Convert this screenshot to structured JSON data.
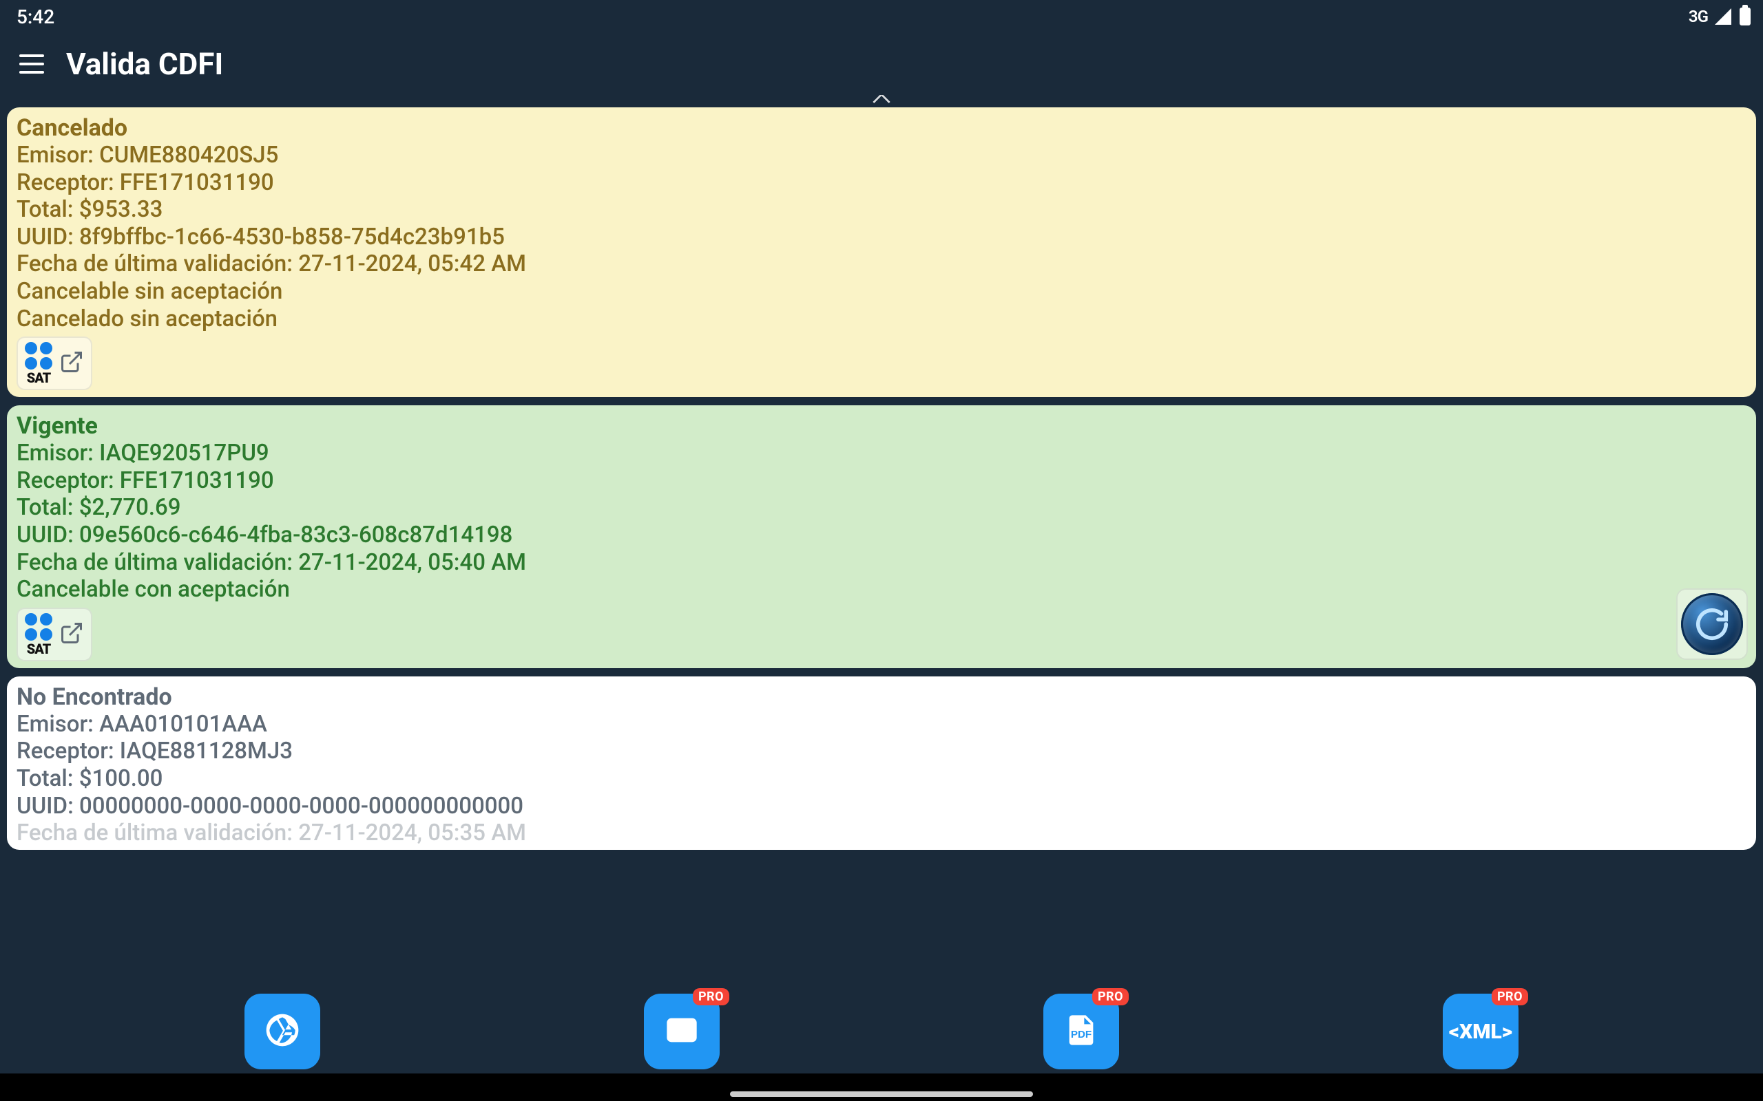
{
  "statusBar": {
    "time": "5:42",
    "network": "3G"
  },
  "appBar": {
    "title": "Valida CDFI"
  },
  "labels": {
    "emisor": "Emisor: ",
    "receptor": "Receptor: ",
    "total": "Total: ",
    "uuid": "UUID: ",
    "lastValidation": "Fecha de última validación: ",
    "sat": "SAT",
    "pro": "PRO",
    "xml": "<XML>"
  },
  "cards": [
    {
      "status": "Cancelado",
      "styleKey": "cancelado",
      "emisor": "CUME880420SJ5",
      "receptor": "FFE171031190",
      "total": "$953.33",
      "uuid": "8f9bffbc-1c66-4530-b858-75d4c23b91b5",
      "lastValidation": "27-11-2024, 05:42 AM",
      "extra": [
        "Cancelable sin aceptación",
        "Cancelado sin aceptación"
      ],
      "hasRefresh": false
    },
    {
      "status": "Vigente",
      "styleKey": "vigente",
      "emisor": "IAQE920517PU9",
      "receptor": "FFE171031190",
      "total": "$2,770.69",
      "uuid": "09e560c6-c646-4fba-83c3-608c87d14198",
      "lastValidation": "27-11-2024, 05:40 AM",
      "extra": [
        "Cancelable con aceptación"
      ],
      "hasRefresh": true
    },
    {
      "status": "No Encontrado",
      "styleKey": "notfound",
      "emisor": "AAA010101AAA",
      "receptor": "IAQE881128MJ3",
      "total": "$100.00",
      "uuid": "00000000-0000-0000-0000-000000000000",
      "lastValidation": "27-11-2024, 05:35 AM",
      "extra": [],
      "hasRefresh": false,
      "truncated": true
    }
  ]
}
